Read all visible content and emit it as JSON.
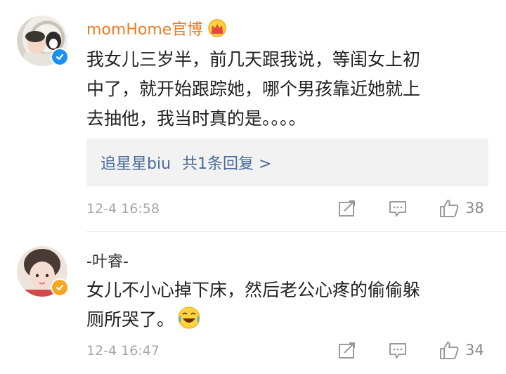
{
  "comments": [
    {
      "username": "momHome官博",
      "username_color": "#f07a24",
      "verify_color": "#1c8ff5",
      "text_lines": [
        "我女儿三岁半，前几天跟我说，等闺女上初",
        "中了，就开始跟踪她，哪个男孩靠近她就上",
        "去抽他，我当时真的是。。。。"
      ],
      "reply": {
        "author": "追星星biu",
        "count_text": "共1条回复"
      },
      "time": "12-4 16:58",
      "likes": "38",
      "badge_icon": "crown-badge-icon"
    },
    {
      "username": "-叶睿-",
      "username_color": "#333333",
      "verify_color": "#f5a623",
      "text_lines": [
        "女儿不小心掉下床，然后老公心疼的偷偷躲",
        "厕所哭了。"
      ],
      "emoji_icon": "laugh-cry-emoji-icon",
      "time": "12-4 16:47",
      "likes": "34"
    }
  ]
}
